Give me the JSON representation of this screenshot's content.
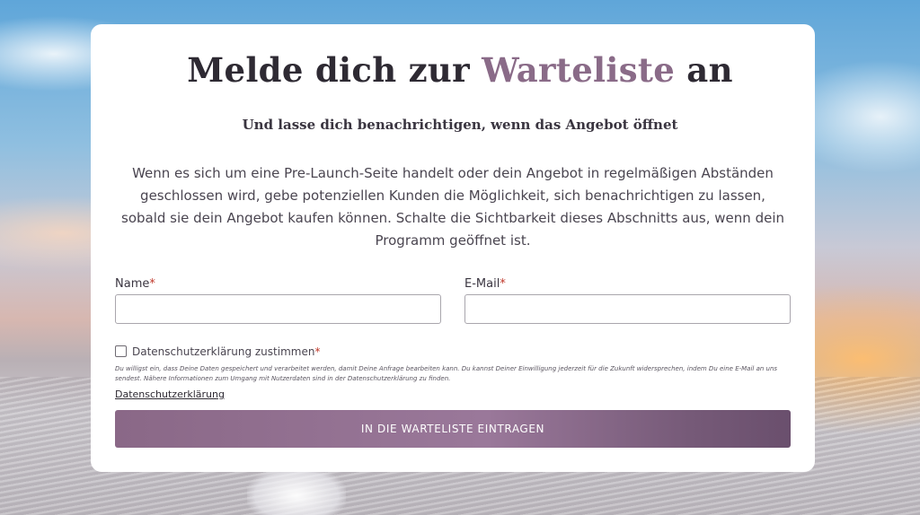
{
  "form": {
    "title_part1": "Melde dich zur ",
    "title_accent": "Warteliste",
    "title_part2": " an",
    "subtitle": "Und lasse dich benachrichtigen, wenn das Angebot öffnet",
    "description": "Wenn es sich um eine Pre-Launch-Seite handelt oder dein Angebot in regelmäßigen Abständen geschlossen wird, gebe potenziellen Kunden die Möglichkeit, sich benachrichtigen zu lassen, sobald sie dein Angebot kaufen können. Schalte die Sichtbarkeit dieses Abschnitts aus, wenn dein Programm geöffnet ist.",
    "name_label": "Name",
    "name_value": "",
    "email_label": "E-Mail",
    "email_value": "",
    "required_marker": "*",
    "privacy_checkbox_label": "Datenschutzerklärung zustimmen",
    "privacy_checked": false,
    "consent_text": "Du willigst ein, dass Deine Daten gespeichert und verarbeitet werden, damit Deine Anfrage bearbeiten kann. Du kannst Deiner Einwilligung jederzeit für die Zukunft widersprechen, indem Du eine E-Mail an uns sendest. Nähere Informationen zum Umgang mit Nutzerdaten sind in der Datenschutzerklärung zu finden.",
    "privacy_link": "Datenschutzerklärung",
    "submit_label": "IN DIE WARTELISTE EINTRAGEN"
  },
  "colors": {
    "accent": "#8a6b88",
    "button_gradient_start": "#8a6887",
    "button_gradient_end": "#6a4f6d",
    "required": "#c0392b"
  }
}
